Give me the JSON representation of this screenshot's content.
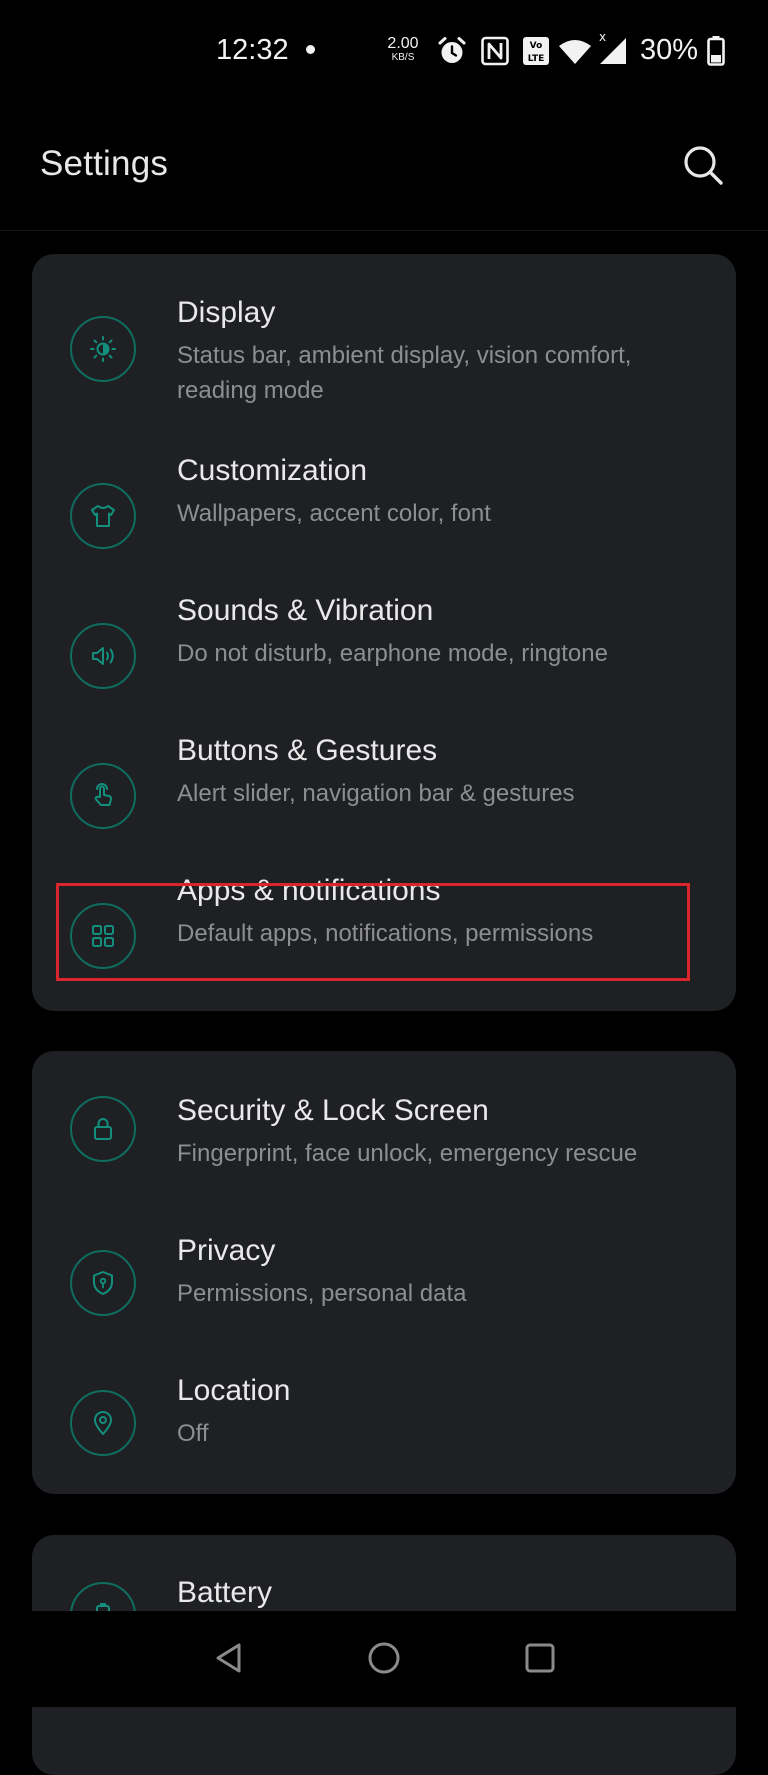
{
  "status_bar": {
    "time": "12:32",
    "net_speed_value": "2.00",
    "net_speed_unit": "KB/S",
    "battery_percent": "30%",
    "icons": [
      "alarm-icon",
      "nfc-icon",
      "volte-icon",
      "wifi-icon",
      "signal-icon",
      "battery-icon"
    ]
  },
  "header": {
    "title": "Settings",
    "search_icon": "search-icon"
  },
  "sections": [
    {
      "items": [
        {
          "title": "Display",
          "subtitle": "Status bar, ambient display, vision comfort, reading mode",
          "icon": "display-brightness-icon"
        },
        {
          "title": "Customization",
          "subtitle": "Wallpapers, accent color, font",
          "icon": "tshirt-icon"
        },
        {
          "title": "Sounds & Vibration",
          "subtitle": "Do not disturb, earphone mode, ringtone",
          "icon": "speaker-icon"
        },
        {
          "title": "Buttons & Gestures",
          "subtitle": "Alert slider, navigation bar & gestures",
          "icon": "gesture-hand-icon"
        },
        {
          "title": "Apps & notifications",
          "subtitle": "Default apps, notifications, permissions",
          "icon": "apps-grid-icon",
          "highlighted": true
        }
      ]
    },
    {
      "items": [
        {
          "title": "Security & Lock Screen",
          "subtitle": "Fingerprint, face unlock, emergency rescue",
          "icon": "lock-icon"
        },
        {
          "title": "Privacy",
          "subtitle": "Permissions, personal data",
          "icon": "shield-icon"
        },
        {
          "title": "Location",
          "subtitle": "Off",
          "icon": "location-pin-icon"
        }
      ]
    },
    {
      "items": [
        {
          "title": "Battery",
          "subtitle": "",
          "icon": "battery-icon"
        }
      ]
    }
  ],
  "nav_bar": {
    "back_icon": "back-triangle-icon",
    "home_icon": "home-circle-icon",
    "recents_icon": "recents-square-icon"
  },
  "colors": {
    "background": "#000000",
    "card": "#1f2024",
    "accent": "#0f6d5f",
    "highlight": "#d9252b",
    "subtitle": "#8d8e91"
  }
}
